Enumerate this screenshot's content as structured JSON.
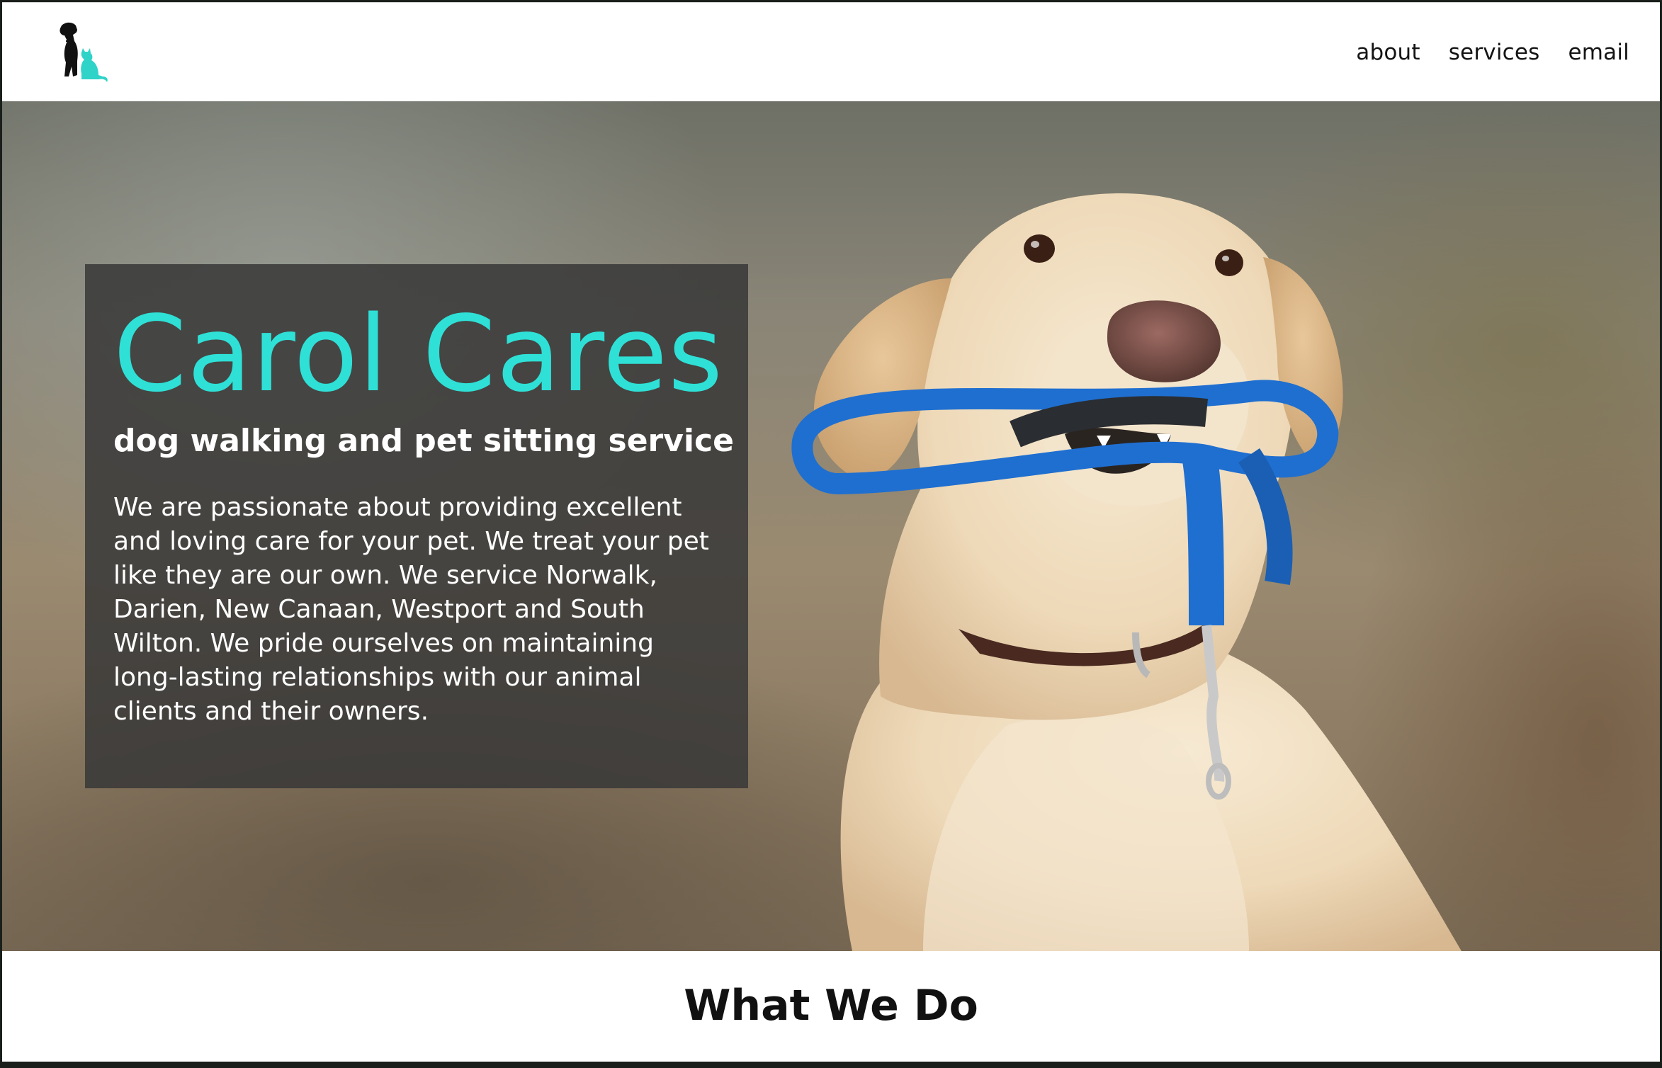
{
  "nav": {
    "links": [
      "about",
      "services",
      "email"
    ]
  },
  "hero": {
    "title": "Carol Cares",
    "subtitle": "dog walking and pet sitting service",
    "description": "We are passionate about providing excellent and loving care for your pet. We treat your pet like they are our own. We service Norwalk, Darien, New Canaan, Westport and South Wilton. We pride ourselves on maintaining long-lasting relationships with our animal clients and their owners."
  },
  "section": {
    "heading": "What We Do"
  },
  "colors": {
    "accent": "#2fe0d6",
    "card_bg": "#373737",
    "leash": "#1f6fd0"
  },
  "icons": {
    "logo": "dog-and-cat-silhouette-icon"
  }
}
